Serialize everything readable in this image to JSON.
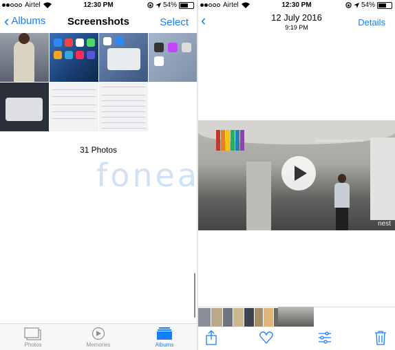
{
  "left": {
    "status": {
      "carrier": "Airtel",
      "time": "12:30 PM",
      "battery": "54%",
      "battery_level": 0.54
    },
    "nav": {
      "back_label": "Albums",
      "title": "Screenshots",
      "select_label": "Select"
    },
    "photo_count": "31 Photos",
    "watermark": "fonearena",
    "tabs": [
      {
        "label": "Photos",
        "icon": "photos-icon",
        "active": false
      },
      {
        "label": "Memories",
        "icon": "memories-icon",
        "active": false
      },
      {
        "label": "Albums",
        "icon": "albums-icon",
        "active": true
      }
    ]
  },
  "right": {
    "status": {
      "carrier": "Airtel",
      "time": "12:30 PM",
      "battery": "54%",
      "battery_level": 0.54
    },
    "nav": {
      "date": "12 July 2016",
      "time": "9:19 PM",
      "details_label": "Details"
    },
    "video_watermark": "nest",
    "toolbar": [
      "share-icon",
      "heart-icon",
      "adjust-icon",
      "trash-icon"
    ]
  },
  "colors": {
    "accent": "#147efb",
    "inactive": "#8e8e93"
  }
}
